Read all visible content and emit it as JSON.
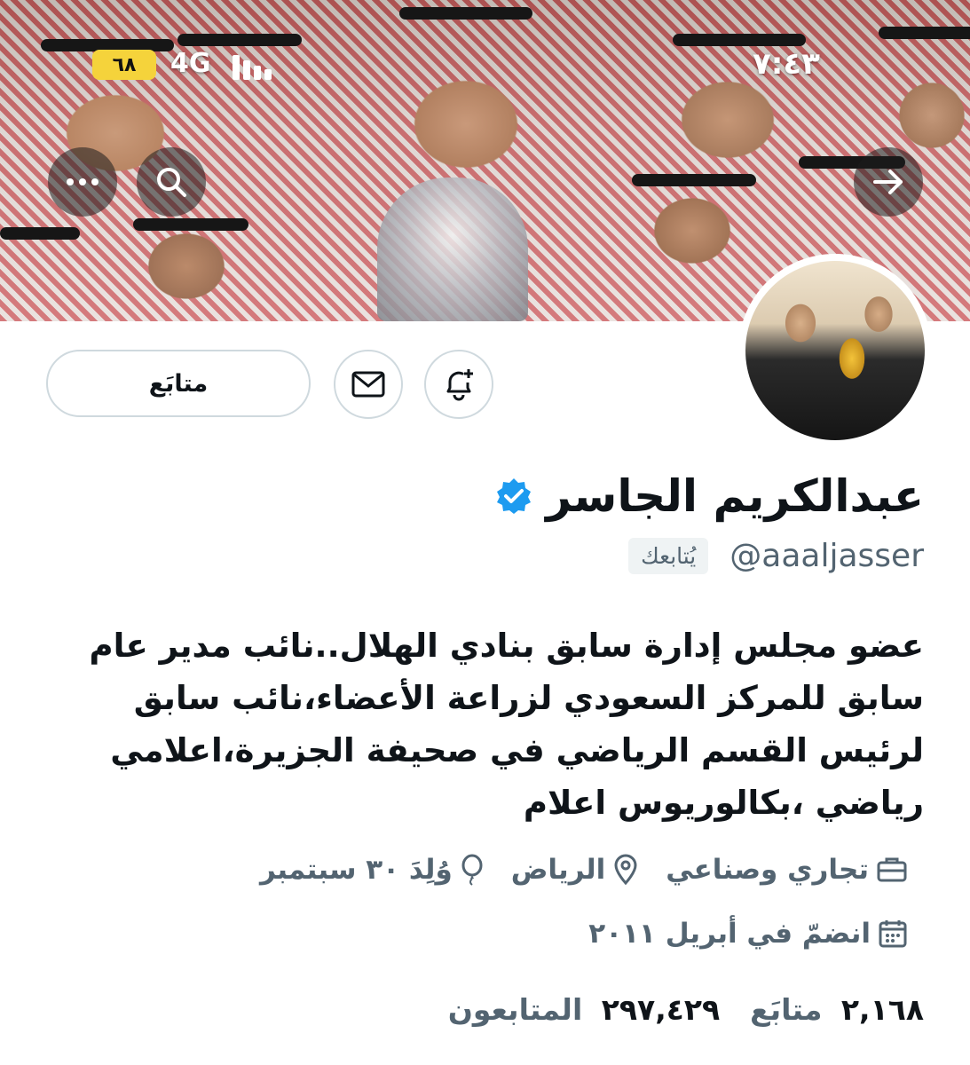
{
  "status_bar": {
    "battery": "٦٨",
    "network": "4G",
    "time": "٧:٤٣"
  },
  "banner": {
    "colors": {
      "headband": "#161616"
    }
  },
  "header_buttons": {
    "more_icon": "more-icon",
    "search_icon": "search-icon",
    "share_icon": "arrow-icon"
  },
  "actions": {
    "follow_label": "متابَع",
    "message_icon": "mail-icon",
    "notify_icon": "bell-plus-icon"
  },
  "profile": {
    "name": "عبدالكريم الجاسر",
    "verified": true,
    "handle": "@aaaljasser",
    "follows_you": "يُتابعك",
    "bio": "عضو مجلس إدارة سابق بنادي الهلال..نائب مدير عام سابق للمركز السعودي لزراعة الأعضاء،نائب سابق لرئيس القسم الرياضي في صحيفة الجزيرة،اعلامي رياضي ،بكالوريوس اعلام",
    "category": "تجاري وصناعي",
    "location": "الرياض",
    "birthday": "وُلِدَ ٣٠ سبتمبر",
    "joined": "انضمّ في أبريل ٢٠١١"
  },
  "stats": {
    "following_count": "٢,١٦٨",
    "following_label": "متابَع",
    "followers_count": "٢٩٧,٤٢٩",
    "followers_label": "المتابعون"
  },
  "colors": {
    "verified": "#1d9bf0",
    "muted": "#536471",
    "battery": "#f5d33b"
  }
}
